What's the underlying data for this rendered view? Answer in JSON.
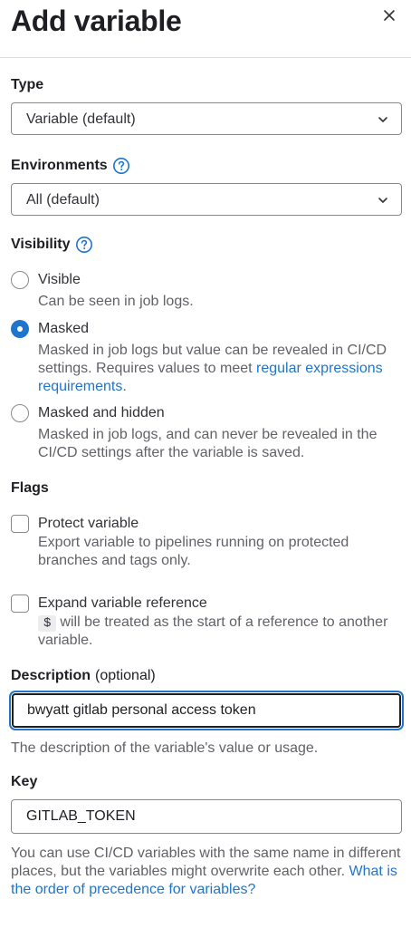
{
  "header": {
    "title": "Add variable",
    "close_icon": "close-icon"
  },
  "type": {
    "label": "Type",
    "selected": "Variable (default)"
  },
  "environments": {
    "label": "Environments",
    "selected": "All (default)"
  },
  "visibility": {
    "label": "Visibility",
    "options": [
      {
        "label": "Visible",
        "help": "Can be seen in job logs.",
        "checked": false
      },
      {
        "label": "Masked",
        "help": "Masked in job logs but value can be revealed in CI/CD settings. Requires values to meet ",
        "link": "regular expressions requirements",
        "help_after": ".",
        "checked": true
      },
      {
        "label": "Masked and hidden",
        "help": "Masked in job logs, and can never be revealed in the CI/CD settings after the variable is saved.",
        "checked": false
      }
    ]
  },
  "flags": {
    "label": "Flags",
    "protect": {
      "label": "Protect variable",
      "help": "Export variable to pipelines running on protected branches and tags only.",
      "checked": false
    },
    "expand": {
      "label": "Expand variable reference",
      "code": "$",
      "help": "will be treated as the start of a reference to another variable.",
      "checked": false
    }
  },
  "description": {
    "label": "Description",
    "optional": "(optional)",
    "value": "bwyatt gitlab personal access token",
    "help": "The description of the variable's value or usage."
  },
  "key": {
    "label": "Key",
    "value": "GITLAB_TOKEN",
    "help": "You can use CI/CD variables with the same name in different places, but the variables might overwrite each other. ",
    "link": "What is the order of precedence for variables?"
  },
  "colors": {
    "accent": "#1f75cb",
    "text": "#333238",
    "muted": "#626168",
    "border": "#89888d"
  }
}
